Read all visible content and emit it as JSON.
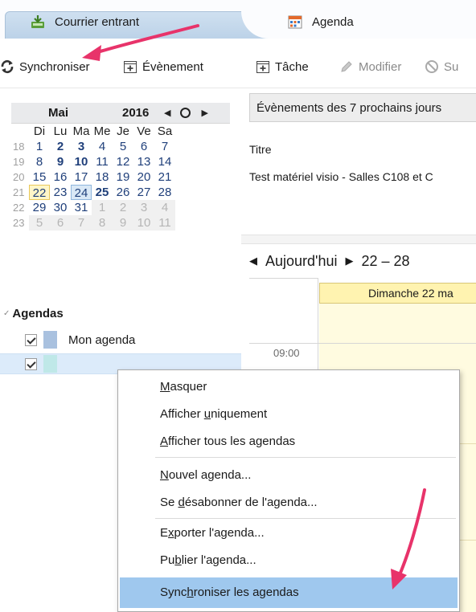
{
  "tabs": [
    {
      "label": "Courrier entrant",
      "icon": "inbox-download-icon"
    },
    {
      "label": "Agenda",
      "icon": "calendar-grid-icon"
    }
  ],
  "toolbar": {
    "sync": "Synchroniser",
    "event": "Évènement",
    "task": "Tâche",
    "modify": "Modifier",
    "delete_partial": "Su"
  },
  "minical": {
    "month": "Mai",
    "year": "2016",
    "weekdays": [
      "Di",
      "Lu",
      "Ma",
      "Me",
      "Je",
      "Ve",
      "Sa"
    ],
    "weeks": [
      {
        "num": "18",
        "days": [
          "1",
          "2",
          "3",
          "4",
          "5",
          "6",
          "7"
        ]
      },
      {
        "num": "19",
        "days": [
          "8",
          "9",
          "10",
          "11",
          "12",
          "13",
          "14"
        ]
      },
      {
        "num": "20",
        "days": [
          "15",
          "16",
          "17",
          "18",
          "19",
          "20",
          "21"
        ]
      },
      {
        "num": "21",
        "days": [
          "22",
          "23",
          "24",
          "25",
          "26",
          "27",
          "28"
        ]
      },
      {
        "num": "22",
        "days": [
          "29",
          "30",
          "31",
          "1",
          "2",
          "3",
          "4"
        ]
      },
      {
        "num": "23",
        "days": [
          "5",
          "6",
          "7",
          "8",
          "9",
          "10",
          "11"
        ]
      }
    ]
  },
  "agendas": {
    "title": "Agendas",
    "items": [
      {
        "name": "Mon agenda",
        "color": "#a9c1df",
        "checked": true
      },
      {
        "name": "",
        "color": "#bfe8e8",
        "checked": true
      }
    ]
  },
  "events_panel": {
    "header": "Évènements des 7 prochains jours",
    "column_title": "Titre",
    "event_title": "Test matériel visio - Salles C108 et C"
  },
  "day_view": {
    "today_label": "Aujourd'hui",
    "range": "22 – 28",
    "day_header": "Dimanche 22 ma",
    "hour": "09:00"
  },
  "context_menu": {
    "masquer": "asquer",
    "masquer_key": "M",
    "afficher_uniquement_a": "Afficher ",
    "afficher_uniquement_key": "u",
    "afficher_uniquement_b": "niquement",
    "afficher_tous_key": "A",
    "afficher_tous": "fficher tous les agendas",
    "nouvel_key": "N",
    "nouvel": "ouvel agenda...",
    "desabonner_a": "Se ",
    "desabonner_key": "d",
    "desabonner_b": "ésabonner de l'agenda...",
    "exporter_a": "E",
    "exporter_key": "x",
    "exporter_b": "porter l'agenda...",
    "publier_a": "Pu",
    "publier_key": "b",
    "publier_b": "lier l'agenda...",
    "sync_a": "Sync",
    "sync_key": "h",
    "sync_b": "roniser les agendas"
  },
  "colors": {
    "annotation_arrow": "#e8336a",
    "menu_highlight": "#9fc8ee",
    "today_highlight": "#fff6c8",
    "selection": "#d9e8f6"
  }
}
